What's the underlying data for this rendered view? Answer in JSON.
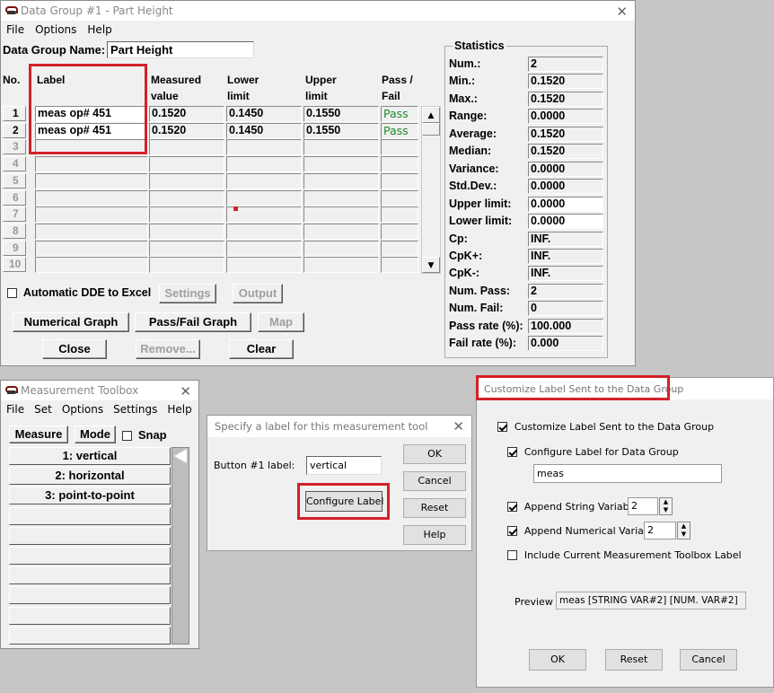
{
  "data_group": {
    "title": "Data Group #1 - Part Height",
    "menu": [
      "File",
      "Options",
      "Help"
    ],
    "name_label": "Data Group Name:",
    "name_value": "Part Height",
    "headers": {
      "no": "No.",
      "label": "Label",
      "measured_1": "Measured",
      "measured_2": "value",
      "lower_1": "Lower",
      "lower_2": "limit",
      "upper_1": "Upper",
      "upper_2": "limit",
      "pass_1": "Pass /",
      "pass_2": "Fail"
    },
    "rows": [
      {
        "no": "1",
        "label": "meas op# 451",
        "measured": "0.1520",
        "lower": "0.1450",
        "upper": "0.1550",
        "pass": "Pass"
      },
      {
        "no": "2",
        "label": "meas op# 451",
        "measured": "0.1520",
        "lower": "0.1450",
        "upper": "0.1550",
        "pass": "Pass"
      },
      {
        "no": "3"
      },
      {
        "no": "4"
      },
      {
        "no": "5"
      },
      {
        "no": "6"
      },
      {
        "no": "7"
      },
      {
        "no": "8"
      },
      {
        "no": "9"
      },
      {
        "no": "10"
      }
    ],
    "dde_label": "Automatic DDE to Excel",
    "settings": "Settings",
    "output": "Output",
    "numerical_graph": "Numerical Graph",
    "passfail_graph": "Pass/Fail Graph",
    "map": "Map",
    "close": "Close",
    "remove": "Remove...",
    "clear": "Clear",
    "stats_title": "Statistics",
    "stats": [
      {
        "label": "Num.:",
        "value": "2"
      },
      {
        "label": "Min.:",
        "value": "0.1520"
      },
      {
        "label": "Max.:",
        "value": "0.1520"
      },
      {
        "label": "Range:",
        "value": "0.0000"
      },
      {
        "label": "Average:",
        "value": "0.1520"
      },
      {
        "label": "Median:",
        "value": "0.1520"
      },
      {
        "label": "Variance:",
        "value": "0.0000"
      },
      {
        "label": "Std.Dev.:",
        "value": "0.0000"
      },
      {
        "label": "Upper limit:",
        "value": "0.0000"
      },
      {
        "label": "Lower limit:",
        "value": "0.0000"
      },
      {
        "label": "Cp:",
        "value": "INF."
      },
      {
        "label": "CpK+:",
        "value": "INF."
      },
      {
        "label": "CpK-:",
        "value": "INF."
      },
      {
        "label": "Num. Pass:",
        "value": "2"
      },
      {
        "label": "Num. Fail:",
        "value": "0"
      },
      {
        "label": "Pass rate (%):",
        "value": "100.000"
      },
      {
        "label": "Fail rate (%):",
        "value": "0.000"
      }
    ]
  },
  "toolbox": {
    "title": "Measurement Toolbox",
    "menu": [
      "File",
      "Set",
      "Options",
      "Settings",
      "Help"
    ],
    "measure": "Measure",
    "mode": "Mode",
    "snap": "Snap",
    "buttons": [
      "1: vertical",
      "2: horizontal",
      "3: point-to-point",
      "",
      "",
      "",
      "",
      "",
      "",
      ""
    ]
  },
  "specify": {
    "title": "Specify a label for this measurement tool",
    "button_label": "Button #1 label:",
    "value": "vertical",
    "configure": "Configure Label",
    "ok": "OK",
    "cancel": "Cancel",
    "reset": "Reset",
    "help": "Help"
  },
  "customize": {
    "title": "Customize Label Sent to the Data Group",
    "cb_customize": "Customize Label Sent to the Data Group",
    "cb_configure": "Configure Label for Data Group",
    "label_value": "meas",
    "cb_string": "Append String Variable:",
    "string_value": "2",
    "cb_numerical": "Append Numerical Variable:",
    "numerical_value": "2",
    "cb_include": "Include Current Measurement Toolbox Label",
    "preview_label": "Preview",
    "preview_value": "meas [STRING VAR#2] [NUM. VAR#2]",
    "ok": "OK",
    "reset": "Reset",
    "cancel": "Cancel"
  },
  "colors": {
    "highlight": "#d42127",
    "pass": "#1a8a2a"
  }
}
